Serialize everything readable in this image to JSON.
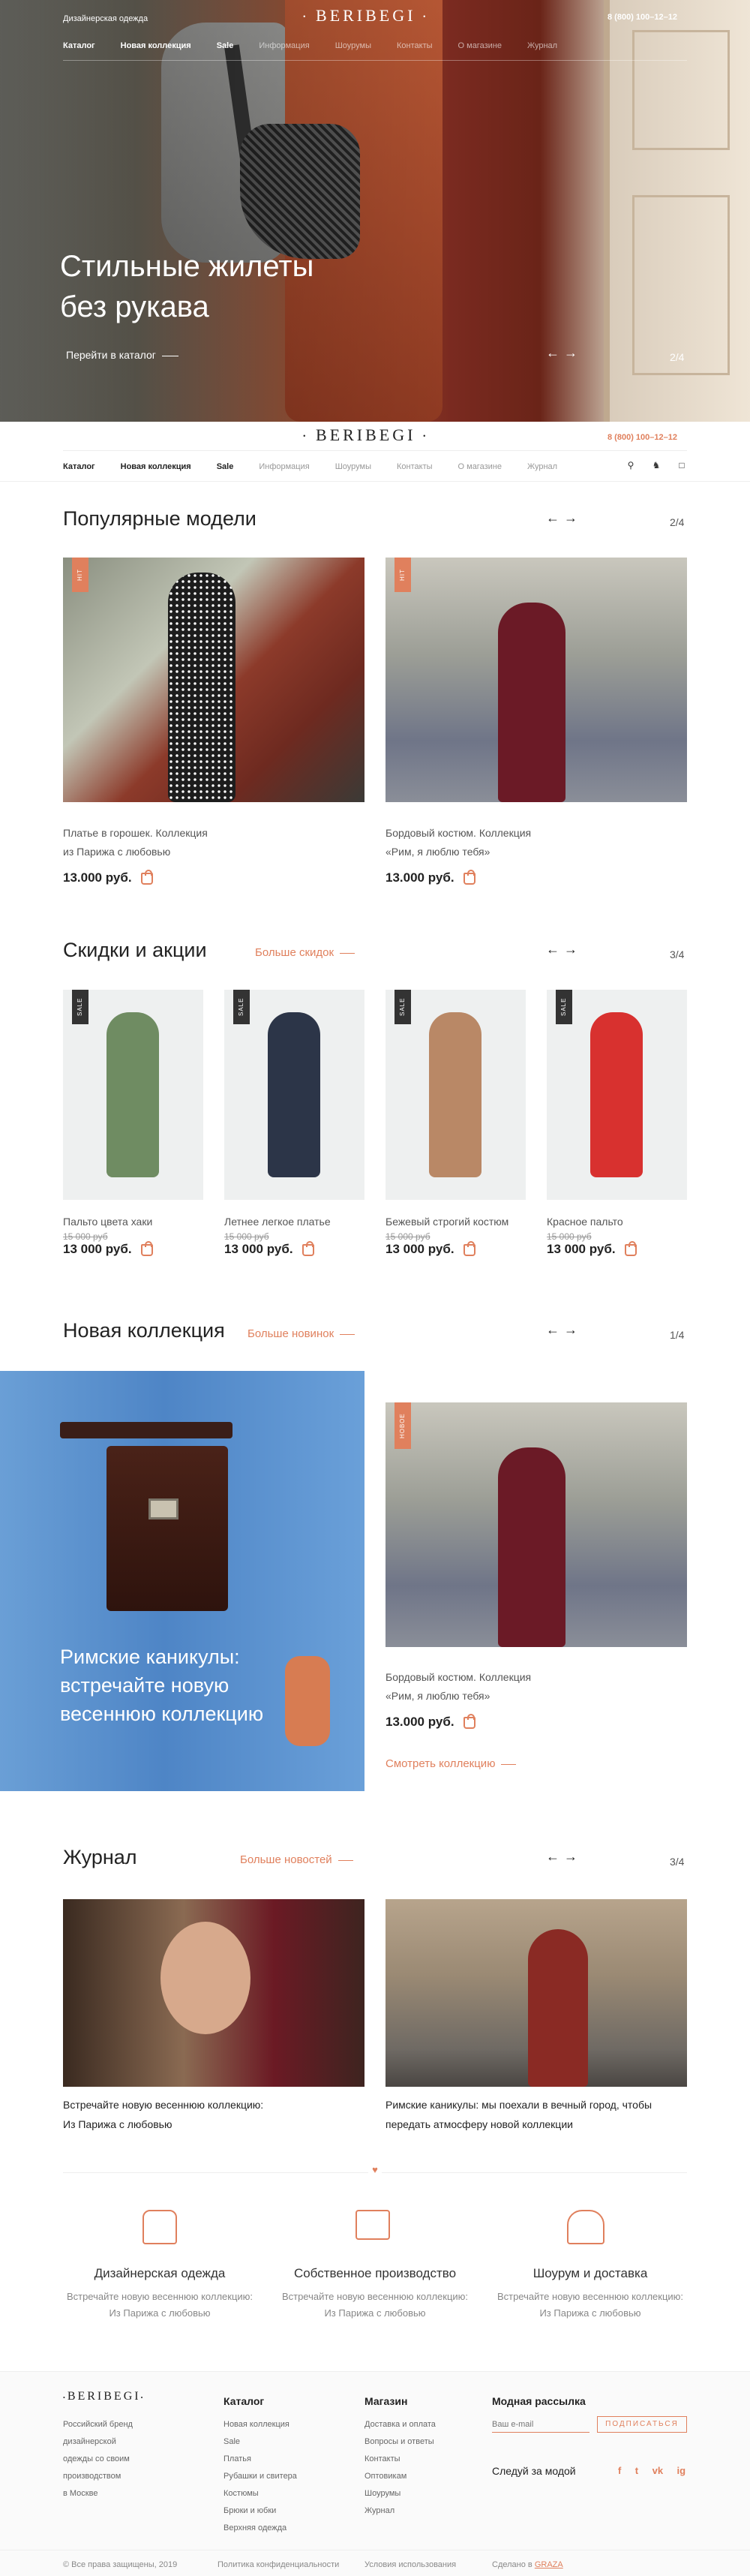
{
  "header": {
    "tagline": "Дизайнерская одежда",
    "logo": "Beribegi",
    "phone": "8 (800) 100–12–12",
    "nav": [
      "Каталог",
      "Новая коллекция",
      "Sale",
      "Информация",
      "Шоурумы",
      "Контакты",
      "О магазине",
      "Журнал"
    ],
    "icons": [
      "search-icon",
      "user-icon",
      "cart-icon"
    ]
  },
  "hero": {
    "title_line1": "Стильные жилеты",
    "title_line2": "без рукава",
    "link": "Перейти в каталог",
    "arrows": "←→",
    "pager": "2/4"
  },
  "popular": {
    "title": "Популярные модели",
    "arrows": "←→",
    "pager": "2/4",
    "items": [
      {
        "tag": "HIT",
        "title_line1": "Платье в горошек. Коллекция",
        "title_line2": "из Парижа с любовью",
        "price": "13.000 руб."
      },
      {
        "tag": "HIT",
        "title_line1": "Бордовый костюм. Коллекция",
        "title_line2": "«Рим, я люблю тебя»",
        "price": "13.000 руб."
      }
    ]
  },
  "sale": {
    "title": "Скидки и акции",
    "more": "Больше скидок",
    "arrows": "←→",
    "pager": "3/4",
    "items": [
      {
        "tag": "SALE",
        "title": "Пальто цвета хаки",
        "old": "15 000 руб",
        "price": "13 000 руб.",
        "color": "#6f8c62"
      },
      {
        "tag": "SALE",
        "title": "Летнее легкое платье",
        "old": "15 000 руб",
        "price": "13 000 руб.",
        "color": "#2c3548"
      },
      {
        "tag": "SALE",
        "title": "Бежевый строгий костюм",
        "old": "15 000 руб",
        "price": "13 000 руб.",
        "color": "#b98866"
      },
      {
        "tag": "SALE",
        "title": "Красное пальто",
        "old": "15 000 руб",
        "price": "13 000 руб.",
        "color": "#d8312f"
      }
    ]
  },
  "collection": {
    "title": "Новая коллекция",
    "more": "Больше новинок",
    "arrows": "←→",
    "pager": "1/4",
    "banner_line1": "Римские каникулы:",
    "banner_line2": "встречайте новую",
    "banner_line3": "весеннюю коллекцию",
    "item": {
      "tag": "НОВОЕ",
      "title_line1": "Бордовый костюм. Коллекция",
      "title_line2": "«Рим, я люблю тебя»",
      "price": "13.000 руб."
    },
    "link": "Смотреть коллекцию"
  },
  "journal": {
    "title": "Журнал",
    "more": "Больше новостей",
    "arrows": "←→",
    "pager": "3/4",
    "items": [
      {
        "line1": "Встречайте новую весеннюю коллекцию:",
        "line2": "Из Парижа с любовью"
      },
      {
        "line1": "Римские каникулы: мы поехали в вечный город, чтобы",
        "line2": "передать атмосферу новой коллекции"
      }
    ]
  },
  "features": [
    {
      "icon": "dress-form-icon",
      "title": "Дизайнерская одежда",
      "line1": "Встречайте новую весеннюю коллекцию:",
      "line2": "Из Парижа с любовью"
    },
    {
      "icon": "sewing-machine-icon",
      "title": "Собственное производство",
      "line1": "Встречайте новую весеннюю коллекцию:",
      "line2": "Из Парижа с любовью"
    },
    {
      "icon": "hanger-icon",
      "title": "Шоурум и доставка",
      "line1": "Встречайте новую весеннюю коллекцию:",
      "line2": "Из Парижа с любовью"
    }
  ],
  "footer": {
    "logo": "Beribegi",
    "about": [
      "Российский бренд",
      "дизайнерской",
      "одежды со своим",
      "производством",
      "в Москве"
    ],
    "catalog_title": "Каталог",
    "catalog": [
      "Новая коллекция",
      "Sale",
      "Платья",
      "Рубашки и свитера",
      "Костюмы",
      "Брюки и юбки",
      "Верхняя одежда"
    ],
    "shop_title": "Магазин",
    "shop": [
      "Доставка и оплата",
      "Вопросы и ответы",
      "Контакты",
      "Оптовикам",
      "Шоурумы",
      "Журнал"
    ],
    "newsletter_title": "Модная рассылка",
    "email_placeholder": "Ваш e-mail",
    "subscribe": "Подписаться",
    "social_title": "Следуй за модой",
    "social": [
      "f",
      "t",
      "vk",
      "ig"
    ],
    "copyright": "© Все права защищены, 2019",
    "privacy": "Политика конфиденциальности",
    "terms": "Условия использования",
    "made_prefix": "Сделано в",
    "made_by": "GRAZA"
  },
  "colors": {
    "accent": "#e0805d"
  }
}
